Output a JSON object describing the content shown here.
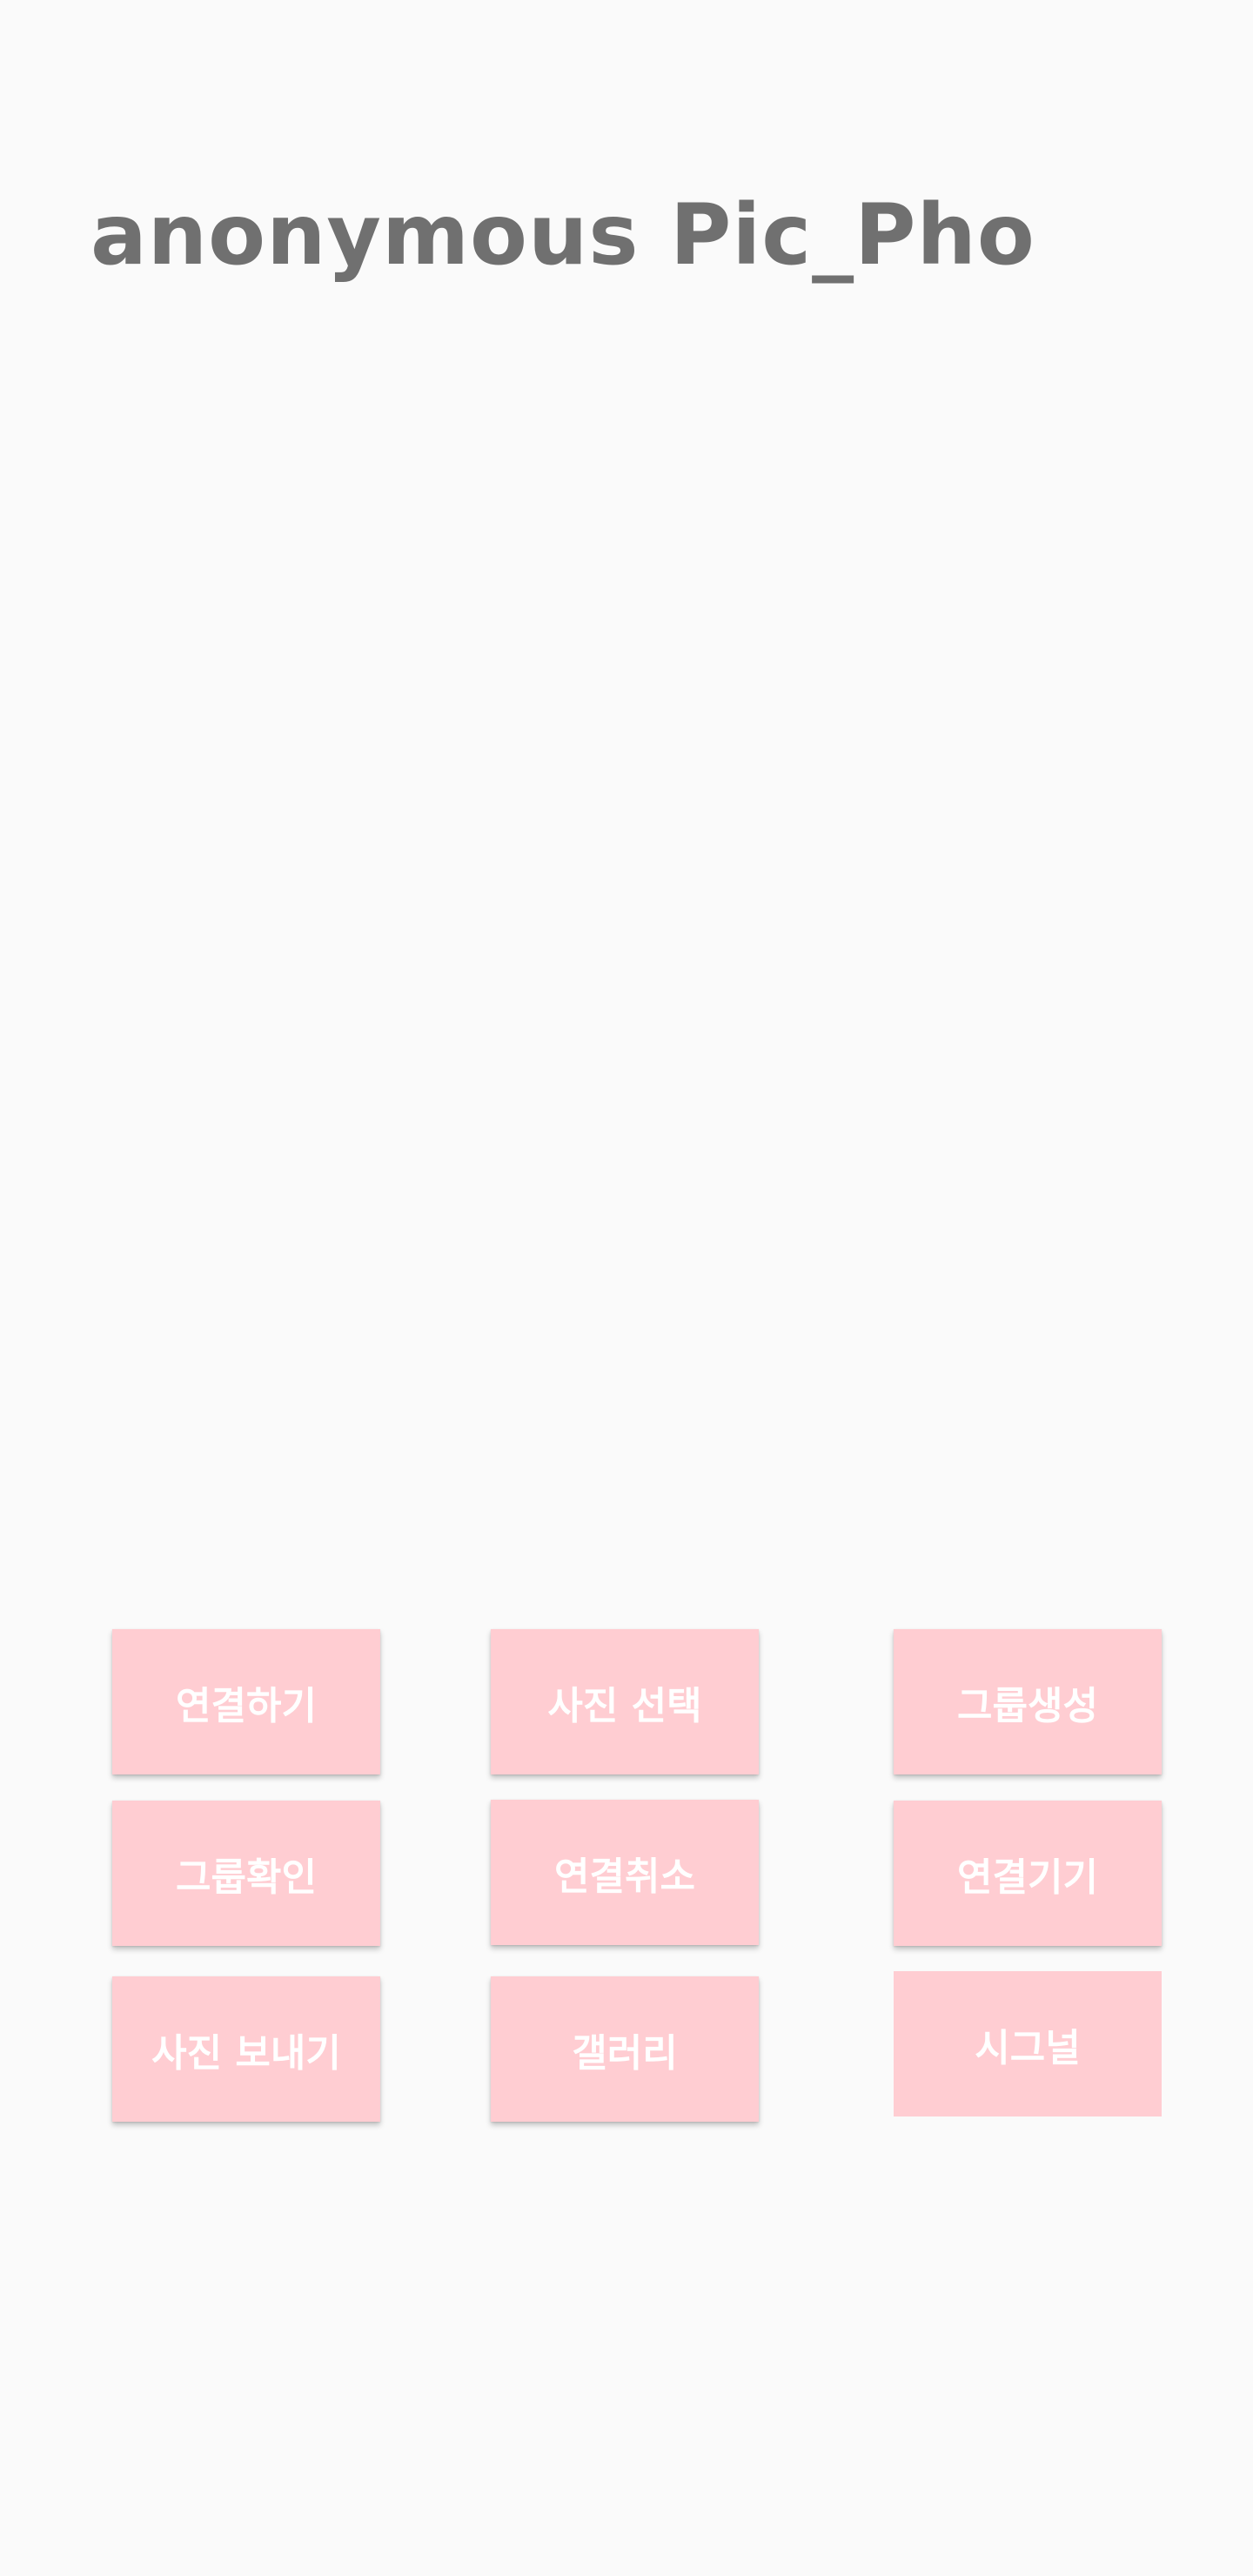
{
  "header": {
    "user_name": "anonymous",
    "app_title": "Pic_Pho"
  },
  "buttons": {
    "connect": "연결하기",
    "select_photo": "사진 선택",
    "create_group": "그룹생성",
    "check_group": "그룹확인",
    "cancel_connection": "연결취소",
    "connected_devices": "연결기기",
    "send_photo": "사진 보내기",
    "gallery": "갤러리",
    "signal": "시그널"
  },
  "colors": {
    "background": "#fafafa",
    "button_bg": "#ffcdd2",
    "button_text": "#ffffff",
    "header_text": "#707070"
  }
}
